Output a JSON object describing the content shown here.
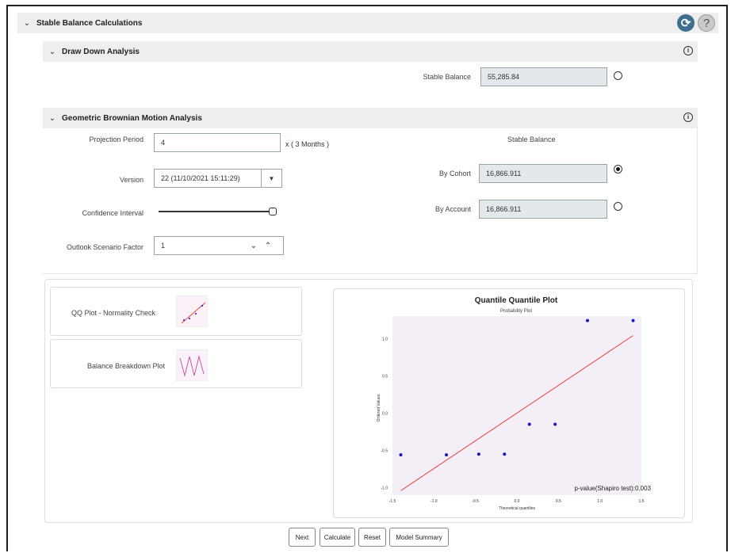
{
  "main_section": {
    "title": "Stable Balance Calculations"
  },
  "draw_down": {
    "title": "Draw Down Analysis",
    "stable_balance_label": "Stable Balance",
    "stable_balance_value": "55,285.84"
  },
  "gbm": {
    "title": "Geometric Brownian Motion Analysis",
    "projection_period_label": "Projection Period",
    "projection_period_value": "4",
    "projection_unit": "x ( 3 Months )",
    "version_label": "Version",
    "version_value": "22 (11/10/2021 15:11:29)",
    "confidence_label": "Confidence Interval",
    "confidence_level": 1.0,
    "outlook_label": "Outlook Scenario Factor",
    "outlook_value": "1",
    "stable_balance_heading": "Stable Balance",
    "by_cohort_label": "By Cohort",
    "by_cohort_value": "16,866.911",
    "by_cohort_selected": true,
    "by_account_label": "By Account",
    "by_account_value": "16,866.911",
    "by_account_selected": false
  },
  "plots": {
    "qq_label": "QQ Plot - Normality Check",
    "balance_label": "Balance Breakdown Plot"
  },
  "chart_data": {
    "type": "scatter",
    "title": "Quantile Quantile Plot",
    "subtitle": "Probability Plot",
    "xlabel": "Theoretical quantiles",
    "ylabel": "Ordered Values",
    "xlim": [
      -1.5,
      1.5
    ],
    "ylim": [
      -1.1,
      1.3
    ],
    "xticks": [
      "-1.5",
      "-1.0",
      "-0.5",
      "0.0",
      "0.5",
      "1.0",
      "1.5"
    ],
    "yticks": [
      "-1.0",
      "-0.5",
      "0.0",
      "0.5",
      "1.0"
    ],
    "x_tick_values": [
      -1.5,
      -1.0,
      -0.5,
      0.0,
      0.5,
      1.0,
      1.5
    ],
    "y_tick_values": [
      -1.0,
      -0.5,
      0.0,
      0.5,
      1.0
    ],
    "points": [
      {
        "x": -1.4,
        "y": -0.56
      },
      {
        "x": -0.85,
        "y": -0.56
      },
      {
        "x": -0.46,
        "y": -0.55
      },
      {
        "x": -0.15,
        "y": -0.55
      },
      {
        "x": 0.15,
        "y": -0.15
      },
      {
        "x": 0.46,
        "y": -0.15
      },
      {
        "x": 0.85,
        "y": 1.24
      },
      {
        "x": 1.4,
        "y": 1.24
      }
    ],
    "fit_line": [
      {
        "x": -1.4,
        "y": -1.04
      },
      {
        "x": 1.4,
        "y": 1.04
      }
    ],
    "annotation": "p-value(Shapiro test):0.003",
    "colors": {
      "points": "#1515c8",
      "line": "#e8473b",
      "background": "#f4eef6"
    }
  },
  "buttons": {
    "next": "Next",
    "calculate": "Calculate",
    "reset": "Reset",
    "model_summary": "Model Summary"
  }
}
